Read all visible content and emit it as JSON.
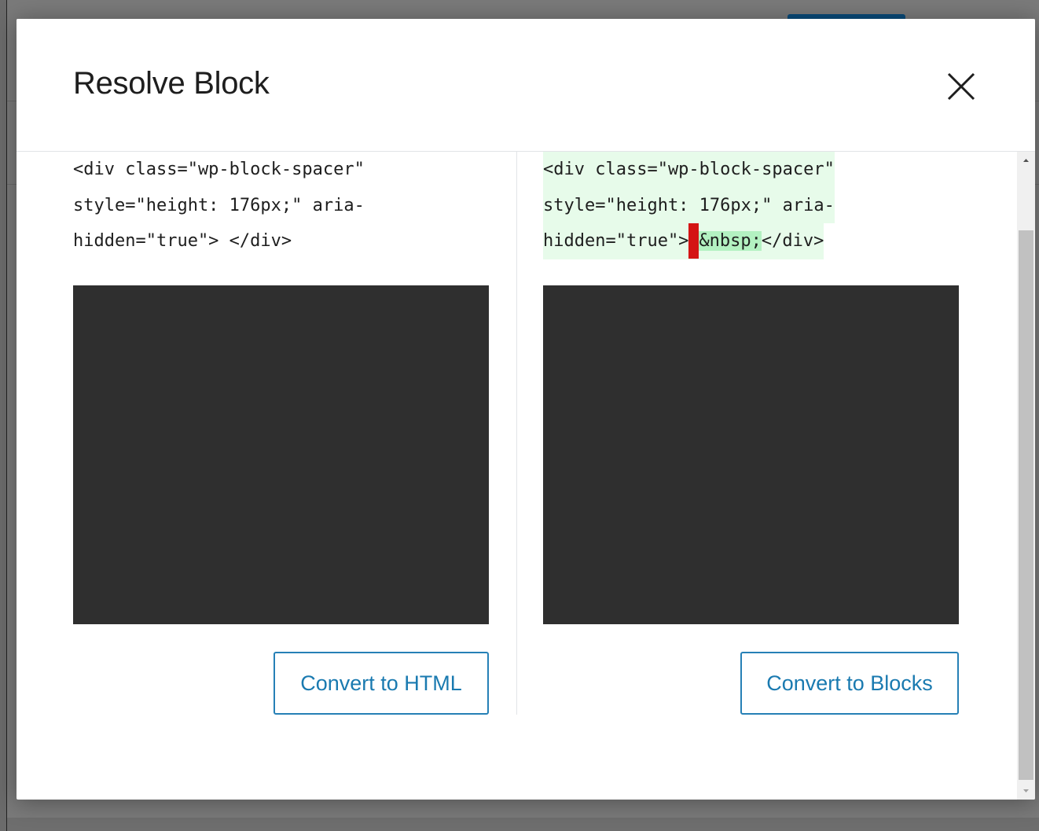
{
  "modal": {
    "title": "Resolve Block",
    "close_icon": "close-icon"
  },
  "left": {
    "code_lines": [
      "<div class=\"wp-block-spacer\"",
      "style=\"height: 176px;\" aria-",
      "hidden=\"true\"> </div>"
    ],
    "button_label": "Convert to HTML"
  },
  "right": {
    "code_lines": [
      "<div class=\"wp-block-spacer\"",
      "style=\"height: 176px;\" aria-"
    ],
    "last_line_prefix": "hidden=\"true\">",
    "last_line_added": "&nbsp;",
    "last_line_suffix": "</div>",
    "button_label": "Convert to Blocks"
  },
  "colors": {
    "accent": "#2680b6",
    "diff_removed": "#d41414",
    "diff_added": "#b3f1c1",
    "diff_line": "#e7fbea",
    "preview_bg": "#2f2f2f"
  }
}
